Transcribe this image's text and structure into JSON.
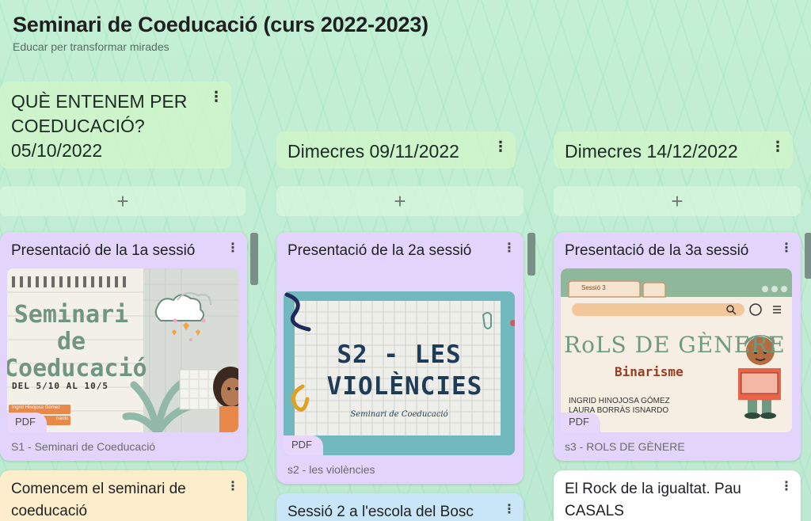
{
  "header": {
    "title": "Seminari de Coeducació (curs 2022-2023)",
    "subtitle": "Educar per transformar mirades"
  },
  "columns": [
    {
      "title": "QUÈ ENTENEM PER COEDUCACIÓ? 05/10/2022",
      "add": "+",
      "cards": [
        {
          "title": "Presentació de la 1a sessió",
          "thumb": {
            "line1": "Seminari",
            "line2": "de",
            "line3": "Coeducació",
            "line4": "DEL 5/10 AL 10/5",
            "tag1": "Ingrid Hinojosa Gómez",
            "tag2": "nardo"
          },
          "badge": "PDF",
          "caption": "S1 - Seminari de Coeducació",
          "color": "#e3d4fc"
        },
        {
          "title": "Comencem el seminari de coeducació",
          "color": "#fdeecb"
        }
      ]
    },
    {
      "title": "Dimecres 09/11/2022",
      "add": "+",
      "cards": [
        {
          "title": "Presentació de  la 2a sessió",
          "thumb": {
            "line1": "S2 - LES",
            "line2": "VIOLÈNCIES",
            "line3": "Seminari de Coeducació"
          },
          "badge": "PDF",
          "caption": "s2 - les violències",
          "color": "#e3d4fc"
        },
        {
          "title": "Sessió 2 a l'escola del Bosc",
          "color": "#c8e6f8"
        }
      ]
    },
    {
      "title": "Dimecres 14/12/2022",
      "add": "+",
      "cards": [
        {
          "title": "Presentació de la 3a sessió",
          "thumb": {
            "tab": "Sessió 3",
            "line1": "RoLS DE GÈNERE",
            "line2": "Binarisme",
            "line3": "INGRID HINOJOSA GÓMEZ",
            "line4": "LAURA BORRÀS ISNARDO"
          },
          "badge": "PDF",
          "caption": "s3 - ROLS DE GÈNERE",
          "color": "#e3d4fc"
        },
        {
          "title": "El Rock de la igualtat. Pau CASALS",
          "color": "#ffffff"
        }
      ]
    }
  ],
  "icons": {
    "more": "more-vert-icon",
    "add": "plus-icon",
    "cloud": "cloud-icon",
    "heart": "heart-icon"
  }
}
